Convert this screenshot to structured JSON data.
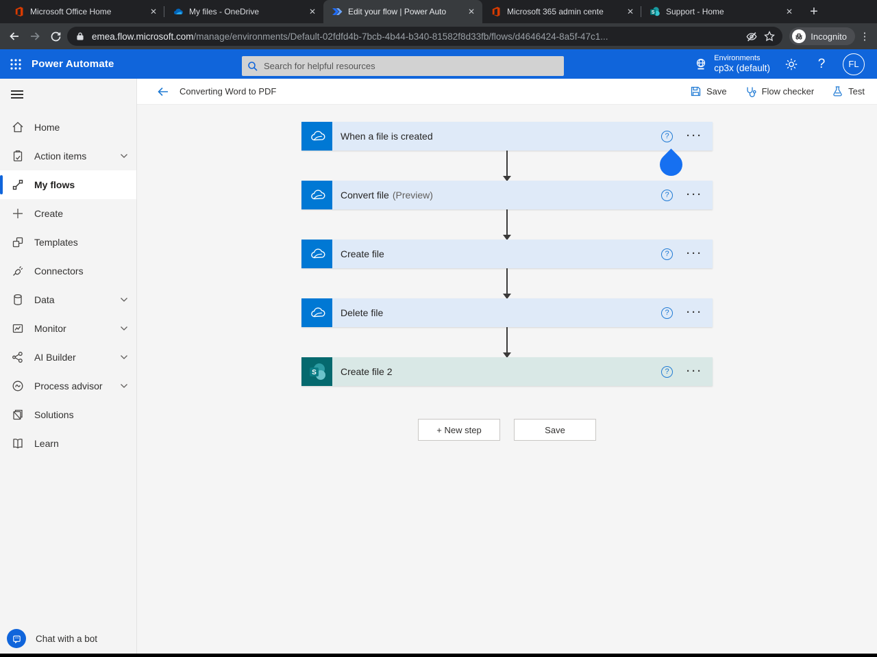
{
  "browser": {
    "tabs": [
      {
        "title": "Microsoft Office Home",
        "icon": "office"
      },
      {
        "title": "My files - OneDrive",
        "icon": "onedrive"
      },
      {
        "title": "Edit your flow | Power Auto",
        "icon": "power-automate"
      },
      {
        "title": "Microsoft 365 admin cente",
        "icon": "office"
      },
      {
        "title": "Support - Home",
        "icon": "sharepoint"
      }
    ],
    "url_domain": "emea.flow.microsoft.com",
    "url_path": "/manage/environments/Default-02fdfd4b-7bcb-4b44-b340-81582f8d33fb/flows/d4646424-8a5f-47c1...",
    "incognito_label": "Incognito"
  },
  "header": {
    "app_name": "Power Automate",
    "search_placeholder": "Search for helpful resources",
    "environments_label": "Environments",
    "environment_name": "cp3x (default)",
    "avatar_initials": "FL",
    "help_label": "?"
  },
  "sidebar": {
    "items": [
      {
        "label": "Home"
      },
      {
        "label": "Action items"
      },
      {
        "label": "My flows"
      },
      {
        "label": "Create"
      },
      {
        "label": "Templates"
      },
      {
        "label": "Connectors"
      },
      {
        "label": "Data"
      },
      {
        "label": "Monitor"
      },
      {
        "label": "AI Builder"
      },
      {
        "label": "Process advisor"
      },
      {
        "label": "Solutions"
      },
      {
        "label": "Learn"
      }
    ],
    "chat_label": "Chat with a bot"
  },
  "toolbar": {
    "flow_title": "Converting Word to PDF",
    "save_label": "Save",
    "flow_checker_label": "Flow checker",
    "test_label": "Test"
  },
  "flow": {
    "steps": [
      {
        "title": "When a file is created",
        "suffix": "",
        "connector": "onedrive"
      },
      {
        "title": "Convert file",
        "suffix": "(Preview)",
        "connector": "onedrive"
      },
      {
        "title": "Create file",
        "suffix": "",
        "connector": "onedrive"
      },
      {
        "title": "Delete file",
        "suffix": "",
        "connector": "onedrive"
      },
      {
        "title": "Create file 2",
        "suffix": "",
        "connector": "sharepoint"
      }
    ],
    "new_step_label": "+ New step",
    "save_label": "Save"
  },
  "colors": {
    "header_blue": "#1065db",
    "accent_blue": "#0078d4",
    "onedrive_tile": "#0078d4",
    "sharepoint_tile": "#05696e",
    "card_blue": "#dfeaf8",
    "card_teal": "#d9e8e6",
    "droplet_blue": "#1670f1",
    "canvas_gray": "#f5f5f5"
  }
}
